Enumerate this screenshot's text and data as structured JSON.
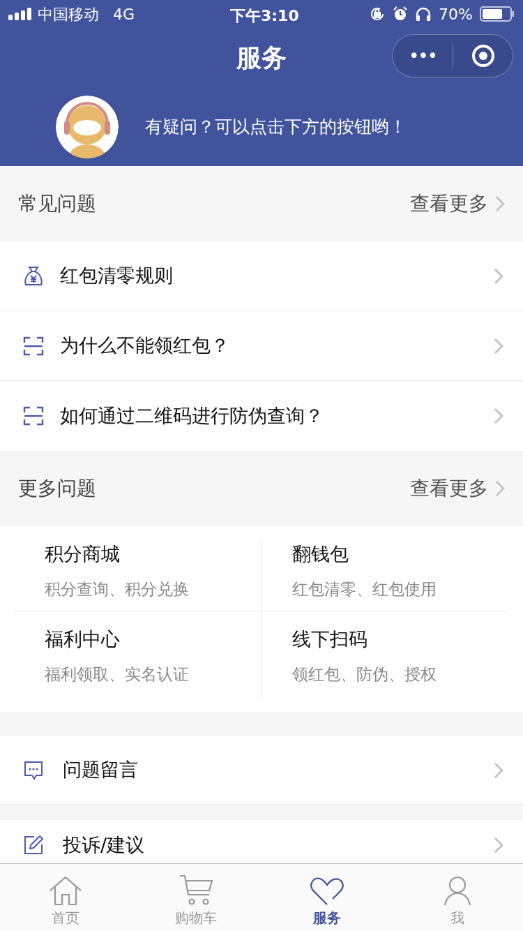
{
  "status_bar": {
    "carrier": "中国移动",
    "network": "4G",
    "time": "下午3:10",
    "battery": "70%"
  },
  "nav": {
    "title": "服务",
    "more": "•••"
  },
  "banner": {
    "text": "有疑问？可以点击下方的按钮哟！"
  },
  "faq": {
    "title": "常见问题",
    "more": "查看更多",
    "items": [
      {
        "kind": "bag",
        "label": "红包清零规则"
      },
      {
        "kind": "scan",
        "label": "为什么不能领红包？"
      },
      {
        "kind": "scan",
        "label": "如何通过二维码进行防伪查询？"
      }
    ]
  },
  "more_questions": {
    "title": "更多问题",
    "more": "查看更多",
    "cards": [
      {
        "title": "积分商城",
        "subtitle": "积分查询、积分兑换"
      },
      {
        "title": "翻钱包",
        "subtitle": "红包清零、红包使用"
      },
      {
        "title": "福利中心",
        "subtitle": "福利领取、实名认证"
      },
      {
        "title": "线下扫码",
        "subtitle": "领红包、防伪、授权"
      }
    ]
  },
  "actions": [
    {
      "kind": "message",
      "label": "问题留言"
    },
    {
      "kind": "edit",
      "label": "投诉/建议"
    }
  ],
  "tab_bar": [
    {
      "kind": "home",
      "label": "首页",
      "selected": false
    },
    {
      "kind": "cart",
      "label": "购物车",
      "selected": false
    },
    {
      "kind": "heart",
      "label": "服务",
      "selected": true
    },
    {
      "kind": "person",
      "label": "我",
      "selected": false
    }
  ]
}
